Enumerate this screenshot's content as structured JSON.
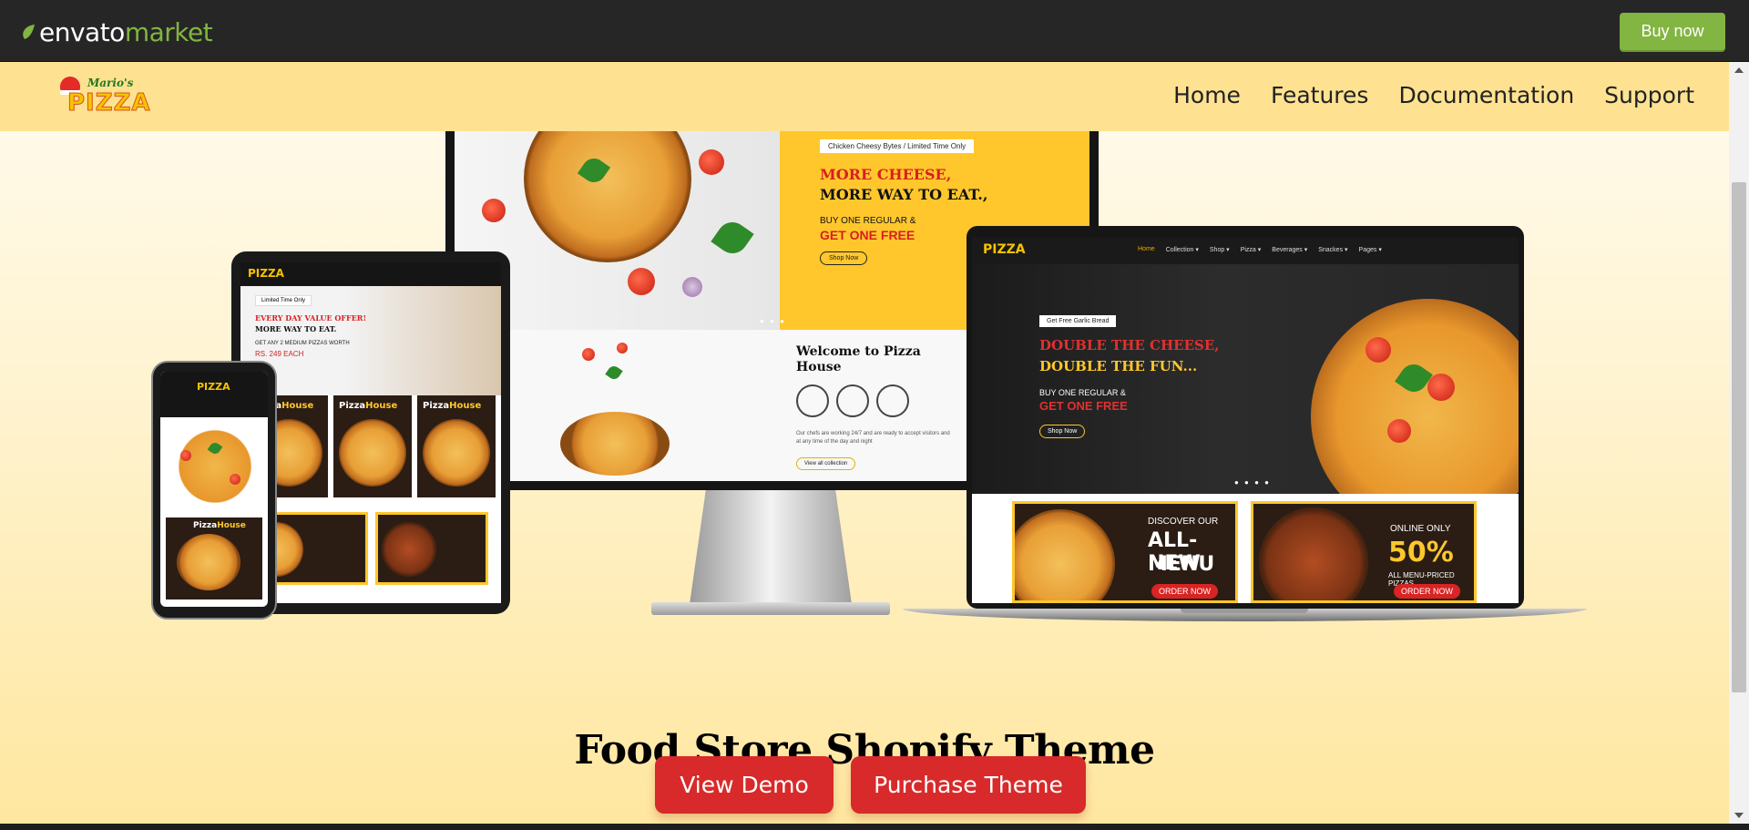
{
  "envato_bar": {
    "logo_word": "envato",
    "logo_market": "market",
    "buy_now_label": "Buy now"
  },
  "site": {
    "logo_small": "Mario's",
    "logo_big": "PIZZA",
    "nav": [
      "Home",
      "Features",
      "Documentation",
      "Support"
    ]
  },
  "monitor": {
    "tag": "Chicken Cheesy Bytes / Limited Time Only",
    "headline_1": "MORE CHEESE,",
    "headline_2": "MORE WAY TO EAT.,",
    "sub_1": "BUY ONE REGULAR &",
    "sub_2": "GET ONE FREE",
    "shop_now": "Shop Now",
    "welcome": "Welcome to Pizza House",
    "desc": "Our chefs are working 24/7 and are ready to accept visitors and at any time of the day and night",
    "view_collection": "View all collection"
  },
  "laptop": {
    "logo": "PIZZA",
    "menu": [
      "Home",
      "Collection ▾",
      "Shop ▾",
      "Pizza ▾",
      "Beverages ▾",
      "Snackes ▾",
      "Pages ▾"
    ],
    "tag": "Get Free Garlic Bread",
    "headline_1": "DOUBLE THE CHEESE,",
    "headline_2": "DOUBLE THE FUN...",
    "sub_1": "BUY ONE REGULAR &",
    "sub_2": "GET ONE FREE",
    "shop_now": "Shop Now",
    "promo_1_small": "DISCOVER OUR",
    "promo_1_big": "ALL-NEW",
    "promo_1_big2": "MENU",
    "promo_1_btn": "ORDER NOW",
    "promo_2_small": "ONLINE ONLY",
    "promo_2_big": "50%",
    "promo_2_sub": "ALL MENU-PRICED PIZZAS",
    "promo_2_btn": "ORDER NOW"
  },
  "tablet": {
    "logo": "PIZZA",
    "tag": "Limited Time Only",
    "headline_1": "EVERY DAY VALUE OFFER!",
    "headline_2": "MORE WAY TO EAT.",
    "sub_1": "GET ANY 2 MEDIUM PIZZAS WORTH",
    "sub_2": "RS. 249 EACH",
    "card_a": "Pizza",
    "card_b": "House"
  },
  "phone": {
    "logo": "PIZZA",
    "card_a": "Pizza",
    "card_b": "House"
  },
  "hero": {
    "title": "Food Store Shopify Theme",
    "view_demo": "View Demo",
    "purchase": "Purchase Theme"
  },
  "colors": {
    "envato_green": "#82b541",
    "header_yellow": "#ffe291",
    "cta_red": "#d82a2a"
  }
}
